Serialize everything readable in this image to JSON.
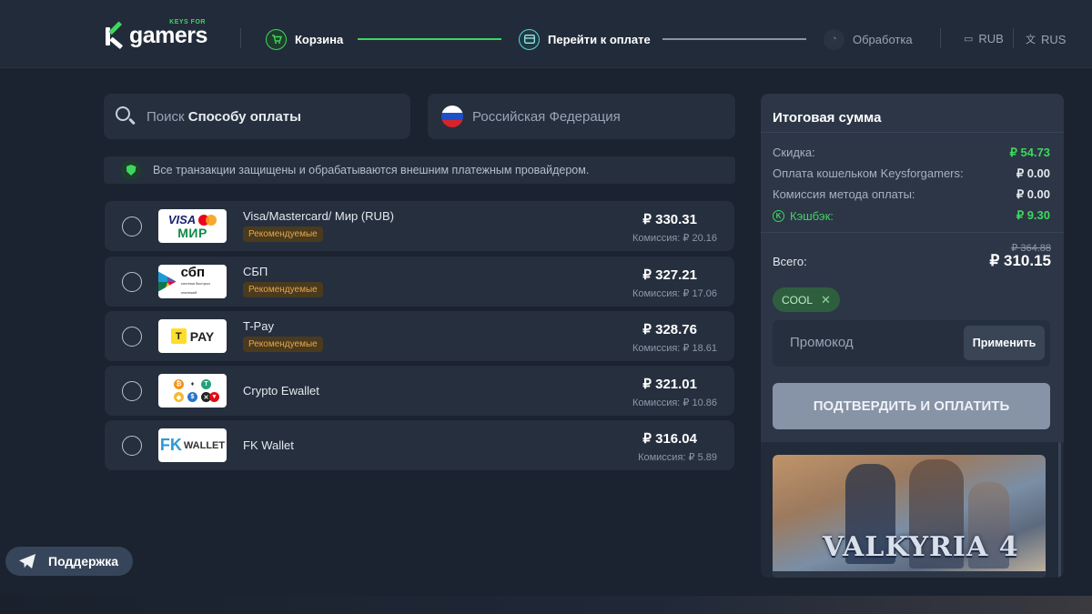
{
  "logo": {
    "small": "KEYS FOR",
    "big": "gamers"
  },
  "steps": [
    {
      "label": "Корзина",
      "icon": "cart-icon"
    },
    {
      "label": "Перейти к оплате",
      "icon": "card-icon"
    },
    {
      "label": "Обработка",
      "icon": "clock-icon"
    }
  ],
  "header": {
    "currency": "RUB",
    "language": "RUS"
  },
  "search": {
    "prefix": "Поиск",
    "bold": "Способу оплаты"
  },
  "country": {
    "label": "Российская Федерация"
  },
  "notice": "Все транзакции защищены и обрабатываются внешним платежным провайдером.",
  "payment_methods": [
    {
      "name": "Visa/Mastercard/ Мир (RUB)",
      "badge": "Рекомендуемые",
      "price": "₽ 330.31",
      "fee": "Комиссия: ₽ 20.16",
      "logo": {
        "visa": "VISA",
        "mir": "МИР"
      }
    },
    {
      "name": "СБП",
      "badge": "Рекомендуемые",
      "price": "₽ 327.21",
      "fee": "Комиссия: ₽ 17.06",
      "logo": {
        "big": "сбп",
        "small": "система быстрых платежей"
      }
    },
    {
      "name": "T-Pay",
      "badge": "Рекомендуемые",
      "price": "₽ 328.76",
      "fee": "Комиссия: ₽ 18.61",
      "logo": {
        "mark": "T",
        "text": "PAY"
      }
    },
    {
      "name": "Crypto Ewallet",
      "badge": "",
      "price": "₽ 321.01",
      "fee": "Комиссия: ₽ 10.86",
      "logo": {}
    },
    {
      "name": "FK Wallet",
      "badge": "",
      "price": "₽ 316.04",
      "fee": "Комиссия: ₽ 5.89",
      "logo": {
        "fk": "FK",
        "text": "WALLET"
      }
    }
  ],
  "summary": {
    "title": "Итоговая сумма",
    "discount_label": "Скидка:",
    "discount_value": "₽ 54.73",
    "wallet_label": "Оплата кошельком Keysforgamers:",
    "wallet_value": "₽ 0.00",
    "fee_label": "Комиссия метода оплаты:",
    "fee_value": "₽ 0.00",
    "cashback_label": "Кэшбэк:",
    "cashback_value": "₽ 9.30",
    "old_total": "₽ 364.88",
    "total_label": "Всего:",
    "total_value": "₽ 310.15",
    "coupon": "COOL",
    "promo_placeholder": "Промокод",
    "apply_label": "Применить",
    "confirm_label": "ПОДТВЕРДИТЬ И ОПЛАТИТЬ",
    "game_title": "VALKYRIA 4"
  },
  "support_label": "Поддержка",
  "colors": {
    "accent": "#3ed65e",
    "badge": "#e7a64a",
    "panel": "#252f3e",
    "background": "#1b2230"
  }
}
